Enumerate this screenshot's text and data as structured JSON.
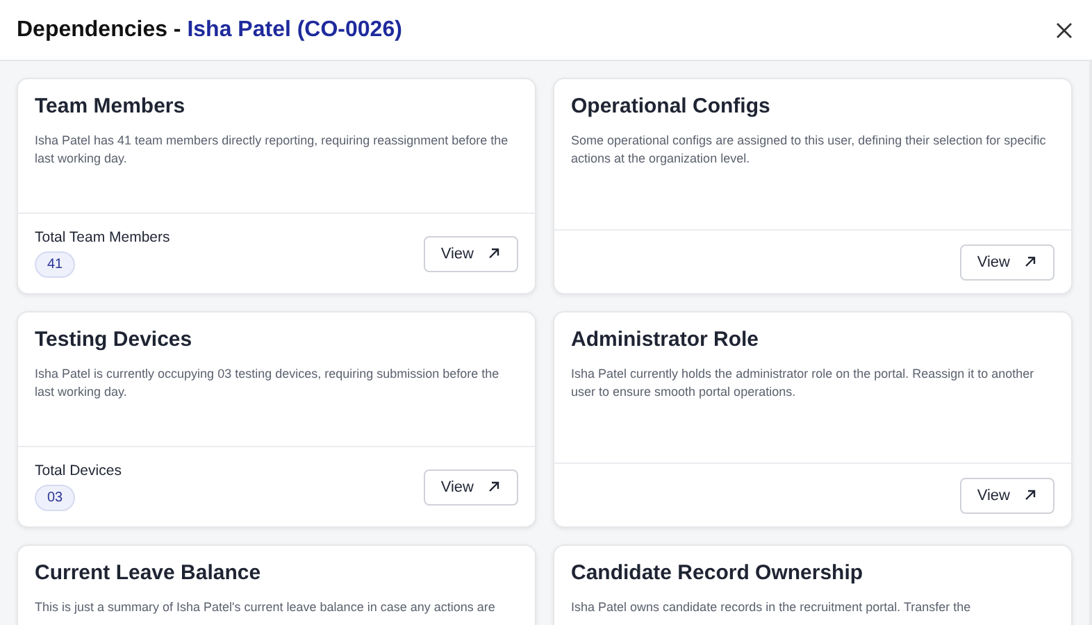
{
  "dialog": {
    "title": "Dependencies - ",
    "subject": "Isha Patel (CO-0026)"
  },
  "cards": [
    {
      "title": "Team Members",
      "description": "Isha Patel has 41 team members directly reporting, requiring reassignment before the last working day.",
      "stat_label": "Total Team Members",
      "stat_value": "41",
      "button": "View"
    },
    {
      "title": "Operational Configs",
      "description": "Some operational configs are assigned to this user, defining their selection for specific actions at the organization level.",
      "button": "View"
    },
    {
      "title": "Testing Devices",
      "description": "Isha Patel is currently occupying 03 testing devices, requiring submission before the last working day.",
      "stat_label": "Total Devices",
      "stat_value": "03",
      "button": "View"
    },
    {
      "title": "Administrator Role",
      "description": "Isha Patel currently holds the administrator role on the portal. Reassign it to another user to ensure smooth portal operations.",
      "button": "View"
    },
    {
      "title": "Current Leave Balance",
      "description": "This is just a summary of Isha Patel's current leave balance in case any actions are"
    },
    {
      "title": "Candidate Record Ownership",
      "description": "Isha Patel owns candidate records in the recruitment portal. Transfer the"
    }
  ]
}
